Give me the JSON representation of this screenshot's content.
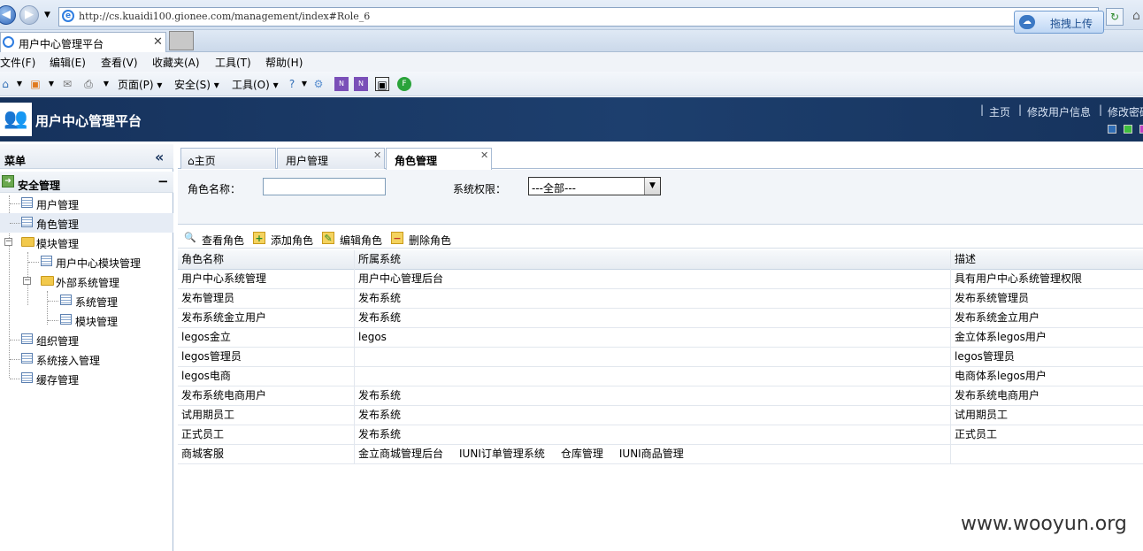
{
  "browser": {
    "url": "http://cs.kuaidi100.gionee.com/management/index#Role_6",
    "tab_title": "用户中心管理平台",
    "upload_label": "拖拽上传",
    "menu": [
      "文件(F)",
      "编辑(E)",
      "查看(V)",
      "收藏夹(A)",
      "工具(T)",
      "帮助(H)"
    ],
    "commands": {
      "page": "页面(P)",
      "safety": "安全(S)",
      "tools": "工具(O)"
    }
  },
  "header": {
    "title": "用户中心管理平台",
    "links": [
      "主页",
      "修改用户信息",
      "修改密码"
    ],
    "theme_colors": [
      "#2f6db5",
      "#3fbf3f",
      "#c23fc2"
    ]
  },
  "sidebar": {
    "title": "菜单",
    "group": "安全管理",
    "items": {
      "user": "用户管理",
      "role": "角色管理",
      "module": "模块管理",
      "uc_module": "用户中心模块管理",
      "ext_system": "外部系统管理",
      "system": "系统管理",
      "module2": "模块管理",
      "org": "组织管理",
      "sys_access": "系统接入管理",
      "cache": "缓存管理"
    }
  },
  "tabs": {
    "home": "主页",
    "user": "用户管理",
    "role": "角色管理"
  },
  "search": {
    "role_name_label": "角色名称：",
    "role_name_value": "",
    "perm_label": "系统权限：",
    "perm_value": "---全部---"
  },
  "toolbar": {
    "view": "查看角色",
    "add": "添加角色",
    "edit": "编辑角色",
    "delete": "删除角色"
  },
  "grid": {
    "columns": [
      "角色名称",
      "所属系统",
      "描述"
    ],
    "rows": [
      {
        "name": "用户中心系统管理",
        "systems": [
          "用户中心管理后台"
        ],
        "desc": "具有用户中心系统管理权限"
      },
      {
        "name": "发布管理员",
        "systems": [
          "发布系统"
        ],
        "desc": "发布系统管理员"
      },
      {
        "name": "发布系统金立用户",
        "systems": [
          "发布系统"
        ],
        "desc": "发布系统金立用户"
      },
      {
        "name": "legos金立",
        "systems": [
          "legos"
        ],
        "desc": "金立体系legos用户"
      },
      {
        "name": "legos管理员",
        "systems": [],
        "desc": "legos管理员"
      },
      {
        "name": "legos电商",
        "systems": [],
        "desc": "电商体系legos用户"
      },
      {
        "name": "发布系统电商用户",
        "systems": [
          "发布系统"
        ],
        "desc": "发布系统电商用户"
      },
      {
        "name": "试用期员工",
        "systems": [
          "发布系统"
        ],
        "desc": "试用期员工"
      },
      {
        "name": "正式员工",
        "systems": [
          "发布系统"
        ],
        "desc": "正式员工"
      },
      {
        "name": "商城客服",
        "systems": [
          "金立商城管理后台",
          "IUNI订单管理系统",
          "仓库管理",
          "IUNI商品管理"
        ],
        "desc": ""
      }
    ]
  },
  "watermark": "www.wooyun.org"
}
